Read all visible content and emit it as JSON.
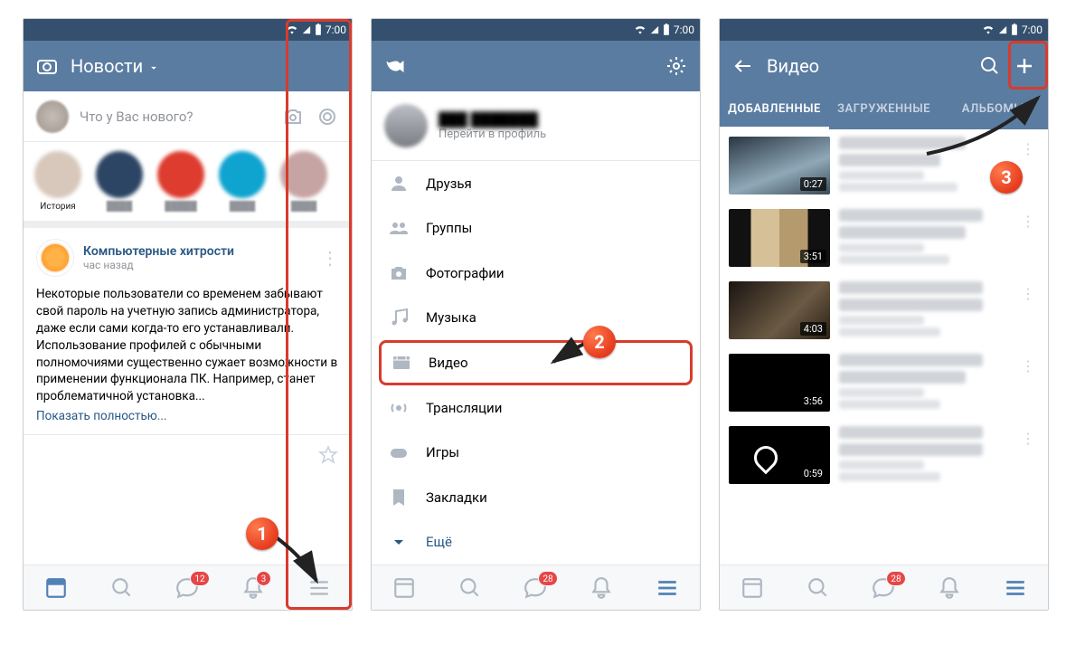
{
  "status_time": "7:00",
  "phone1": {
    "header_title": "Новости",
    "compose_placeholder": "Что у Вас нового?",
    "story_label": "История",
    "post": {
      "group": "Компьютерные хитрости",
      "time": "час назад",
      "text": "Некоторые пользователи со временем забывают свой пароль на учетную запись администратора, даже если сами когда-то его устанавливали. Использование профилей с обычными полномочиями существенно сужает возможности в применении функционала ПК. Например, станет проблематичной установка...",
      "show_more": "Показать полностью..."
    },
    "badges": {
      "messages": "12",
      "notifications": "3"
    }
  },
  "phone2": {
    "profile_link": "Перейти в профиль",
    "menu": {
      "friends": "Друзья",
      "groups": "Группы",
      "photos": "Фотографии",
      "music": "Музыка",
      "video": "Видео",
      "live": "Трансляции",
      "games": "Игры",
      "bookmarks": "Закладки",
      "more": "Ещё"
    },
    "badges": {
      "messages": "28"
    }
  },
  "phone3": {
    "header_title": "Видео",
    "tabs": {
      "added": "ДОБАВЛЕННЫЕ",
      "uploaded": "ЗАГРУЖЕННЫЕ",
      "albums": "АЛЬБОМЫ"
    },
    "videos": [
      {
        "duration": "0:27"
      },
      {
        "duration": "3:51"
      },
      {
        "duration": "4:03"
      },
      {
        "duration": "3:56"
      },
      {
        "duration": "0:59"
      }
    ],
    "badges": {
      "messages": "28"
    }
  },
  "annotations": {
    "n1": "1",
    "n2": "2",
    "n3": "3"
  }
}
